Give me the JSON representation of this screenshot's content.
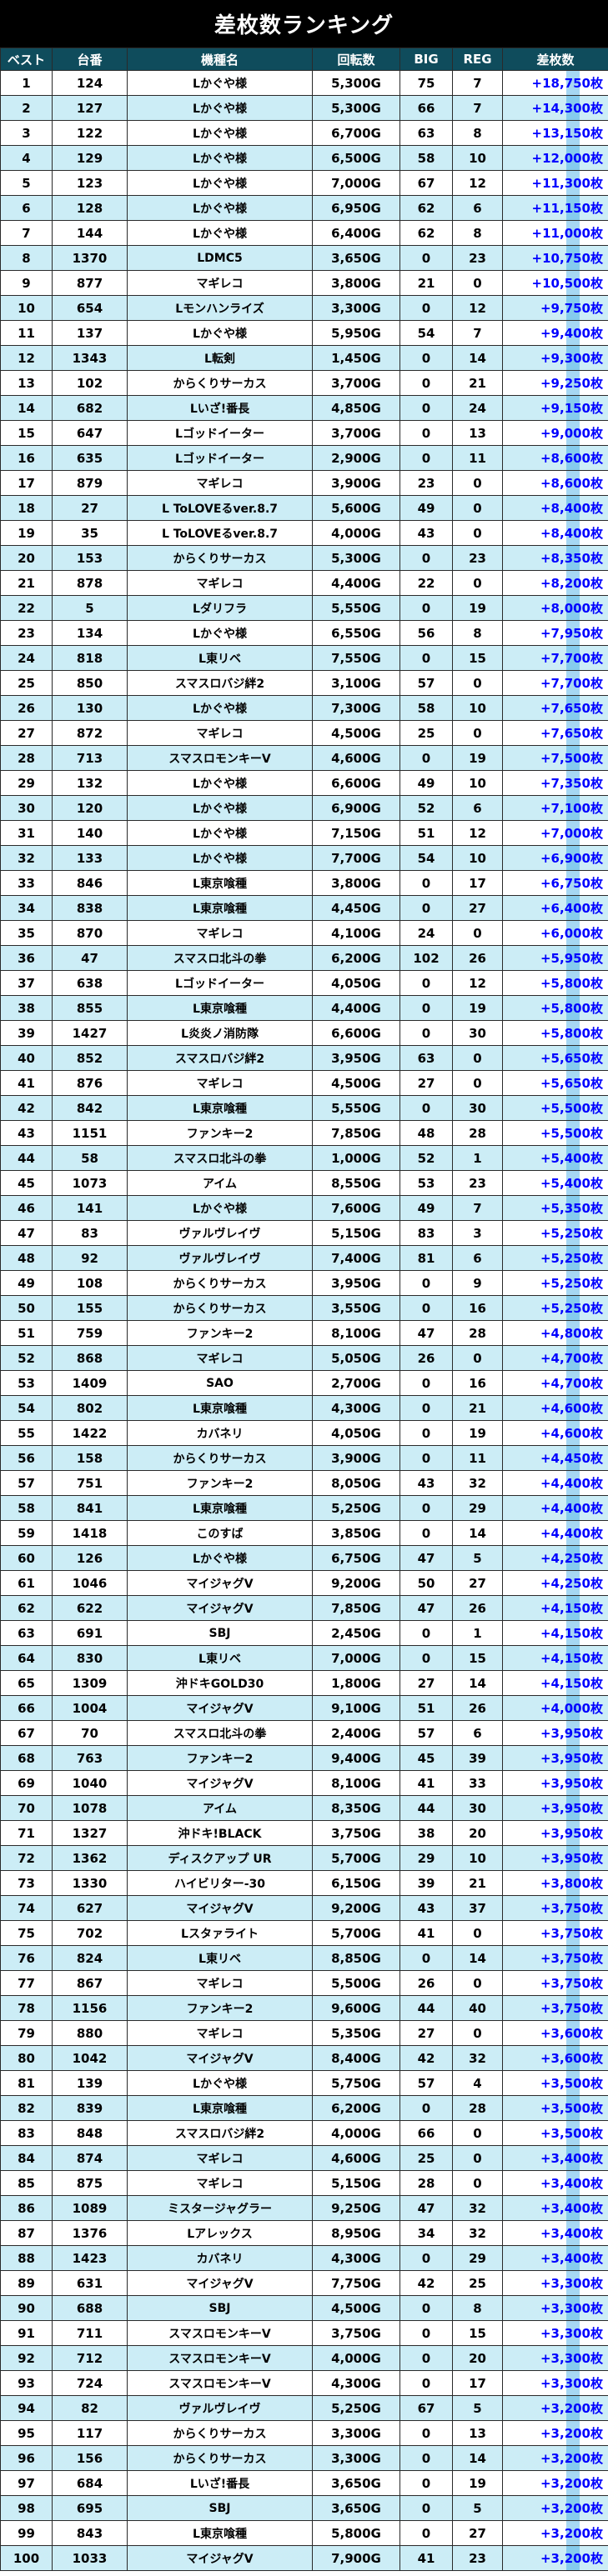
{
  "title": "差枚数ランキング",
  "headers": [
    "ベスト",
    "台番",
    "機種名",
    "回転数",
    "BIG",
    "REG",
    "差枚数"
  ],
  "rows": [
    [
      "1",
      "124",
      "Lかぐや様",
      "5,300G",
      "75",
      "7",
      "+18,750枚"
    ],
    [
      "2",
      "127",
      "Lかぐや様",
      "5,300G",
      "66",
      "7",
      "+14,300枚"
    ],
    [
      "3",
      "122",
      "Lかぐや様",
      "6,700G",
      "63",
      "8",
      "+13,150枚"
    ],
    [
      "4",
      "129",
      "Lかぐや様",
      "6,500G",
      "58",
      "10",
      "+12,000枚"
    ],
    [
      "5",
      "123",
      "Lかぐや様",
      "7,000G",
      "67",
      "12",
      "+11,300枚"
    ],
    [
      "6",
      "128",
      "Lかぐや様",
      "6,950G",
      "62",
      "6",
      "+11,150枚"
    ],
    [
      "7",
      "144",
      "Lかぐや様",
      "6,400G",
      "62",
      "8",
      "+11,000枚"
    ],
    [
      "8",
      "1370",
      "LDMC5",
      "3,650G",
      "0",
      "23",
      "+10,750枚"
    ],
    [
      "9",
      "877",
      "マギレコ",
      "3,800G",
      "21",
      "0",
      "+10,500枚"
    ],
    [
      "10",
      "654",
      "Lモンハンライズ",
      "3,300G",
      "0",
      "12",
      "+9,750枚"
    ],
    [
      "11",
      "137",
      "Lかぐや様",
      "5,950G",
      "54",
      "7",
      "+9,400枚"
    ],
    [
      "12",
      "1343",
      "L転剣",
      "1,450G",
      "0",
      "14",
      "+9,300枚"
    ],
    [
      "13",
      "102",
      "からくりサーカス",
      "3,700G",
      "0",
      "21",
      "+9,250枚"
    ],
    [
      "14",
      "682",
      "Lいざ!番長",
      "4,850G",
      "0",
      "24",
      "+9,150枚"
    ],
    [
      "15",
      "647",
      "Lゴッドイーター",
      "3,700G",
      "0",
      "13",
      "+9,000枚"
    ],
    [
      "16",
      "635",
      "Lゴッドイーター",
      "2,900G",
      "0",
      "11",
      "+8,600枚"
    ],
    [
      "17",
      "879",
      "マギレコ",
      "3,900G",
      "23",
      "0",
      "+8,600枚"
    ],
    [
      "18",
      "27",
      "L ToLOVEるver.8.7",
      "5,600G",
      "49",
      "0",
      "+8,400枚"
    ],
    [
      "19",
      "35",
      "L ToLOVEるver.8.7",
      "4,000G",
      "43",
      "0",
      "+8,400枚"
    ],
    [
      "20",
      "153",
      "からくりサーカス",
      "5,300G",
      "0",
      "23",
      "+8,350枚"
    ],
    [
      "21",
      "878",
      "マギレコ",
      "4,400G",
      "22",
      "0",
      "+8,200枚"
    ],
    [
      "22",
      "5",
      "Lダリフラ",
      "5,550G",
      "0",
      "19",
      "+8,000枚"
    ],
    [
      "23",
      "134",
      "Lかぐや様",
      "6,550G",
      "56",
      "8",
      "+7,950枚"
    ],
    [
      "24",
      "818",
      "L東リベ",
      "7,550G",
      "0",
      "15",
      "+7,700枚"
    ],
    [
      "25",
      "850",
      "スマスロバジ絆2",
      "3,100G",
      "57",
      "0",
      "+7,700枚"
    ],
    [
      "26",
      "130",
      "Lかぐや様",
      "7,300G",
      "58",
      "10",
      "+7,650枚"
    ],
    [
      "27",
      "872",
      "マギレコ",
      "4,500G",
      "25",
      "0",
      "+7,650枚"
    ],
    [
      "28",
      "713",
      "スマスロモンキーV",
      "4,600G",
      "0",
      "19",
      "+7,500枚"
    ],
    [
      "29",
      "132",
      "Lかぐや様",
      "6,600G",
      "49",
      "10",
      "+7,350枚"
    ],
    [
      "30",
      "120",
      "Lかぐや様",
      "6,900G",
      "52",
      "6",
      "+7,100枚"
    ],
    [
      "31",
      "140",
      "Lかぐや様",
      "7,150G",
      "51",
      "12",
      "+7,000枚"
    ],
    [
      "32",
      "133",
      "Lかぐや様",
      "7,700G",
      "54",
      "10",
      "+6,900枚"
    ],
    [
      "33",
      "846",
      "L東京喰種",
      "3,800G",
      "0",
      "17",
      "+6,750枚"
    ],
    [
      "34",
      "838",
      "L東京喰種",
      "4,450G",
      "0",
      "27",
      "+6,400枚"
    ],
    [
      "35",
      "870",
      "マギレコ",
      "4,100G",
      "24",
      "0",
      "+6,000枚"
    ],
    [
      "36",
      "47",
      "スマスロ北斗の拳",
      "6,200G",
      "102",
      "26",
      "+5,950枚"
    ],
    [
      "37",
      "638",
      "Lゴッドイーター",
      "4,050G",
      "0",
      "12",
      "+5,800枚"
    ],
    [
      "38",
      "855",
      "L東京喰種",
      "4,400G",
      "0",
      "19",
      "+5,800枚"
    ],
    [
      "39",
      "1427",
      "L炎炎ノ消防隊",
      "6,600G",
      "0",
      "30",
      "+5,800枚"
    ],
    [
      "40",
      "852",
      "スマスロバジ絆2",
      "3,950G",
      "63",
      "0",
      "+5,650枚"
    ],
    [
      "41",
      "876",
      "マギレコ",
      "4,500G",
      "27",
      "0",
      "+5,650枚"
    ],
    [
      "42",
      "842",
      "L東京喰種",
      "5,550G",
      "0",
      "30",
      "+5,500枚"
    ],
    [
      "43",
      "1151",
      "ファンキー2",
      "7,850G",
      "48",
      "28",
      "+5,500枚"
    ],
    [
      "44",
      "58",
      "スマスロ北斗の拳",
      "1,000G",
      "52",
      "1",
      "+5,400枚"
    ],
    [
      "45",
      "1073",
      "アイム",
      "8,550G",
      "53",
      "23",
      "+5,400枚"
    ],
    [
      "46",
      "141",
      "Lかぐや様",
      "7,600G",
      "49",
      "7",
      "+5,350枚"
    ],
    [
      "47",
      "83",
      "ヴァルヴレイヴ",
      "5,150G",
      "83",
      "3",
      "+5,250枚"
    ],
    [
      "48",
      "92",
      "ヴァルヴレイヴ",
      "7,400G",
      "81",
      "6",
      "+5,250枚"
    ],
    [
      "49",
      "108",
      "からくりサーカス",
      "3,950G",
      "0",
      "9",
      "+5,250枚"
    ],
    [
      "50",
      "155",
      "からくりサーカス",
      "3,550G",
      "0",
      "16",
      "+5,250枚"
    ],
    [
      "51",
      "759",
      "ファンキー2",
      "8,100G",
      "47",
      "28",
      "+4,800枚"
    ],
    [
      "52",
      "868",
      "マギレコ",
      "5,050G",
      "26",
      "0",
      "+4,700枚"
    ],
    [
      "53",
      "1409",
      "SAO",
      "2,700G",
      "0",
      "16",
      "+4,700枚"
    ],
    [
      "54",
      "802",
      "L東京喰種",
      "4,300G",
      "0",
      "21",
      "+4,600枚"
    ],
    [
      "55",
      "1422",
      "カバネリ",
      "4,050G",
      "0",
      "19",
      "+4,600枚"
    ],
    [
      "56",
      "158",
      "からくりサーカス",
      "3,900G",
      "0",
      "11",
      "+4,450枚"
    ],
    [
      "57",
      "751",
      "ファンキー2",
      "8,050G",
      "43",
      "32",
      "+4,400枚"
    ],
    [
      "58",
      "841",
      "L東京喰種",
      "5,250G",
      "0",
      "29",
      "+4,400枚"
    ],
    [
      "59",
      "1418",
      "このすば",
      "3,850G",
      "0",
      "14",
      "+4,400枚"
    ],
    [
      "60",
      "126",
      "Lかぐや様",
      "6,750G",
      "47",
      "5",
      "+4,250枚"
    ],
    [
      "61",
      "1046",
      "マイジャグV",
      "9,200G",
      "50",
      "27",
      "+4,250枚"
    ],
    [
      "62",
      "622",
      "マイジャグV",
      "7,850G",
      "47",
      "26",
      "+4,150枚"
    ],
    [
      "63",
      "691",
      "SBJ",
      "2,450G",
      "0",
      "1",
      "+4,150枚"
    ],
    [
      "64",
      "830",
      "L東リベ",
      "7,000G",
      "0",
      "15",
      "+4,150枚"
    ],
    [
      "65",
      "1309",
      "沖ドキGOLD30",
      "1,800G",
      "27",
      "14",
      "+4,150枚"
    ],
    [
      "66",
      "1004",
      "マイジャグV",
      "9,100G",
      "51",
      "26",
      "+4,000枚"
    ],
    [
      "67",
      "70",
      "スマスロ北斗の拳",
      "2,400G",
      "57",
      "6",
      "+3,950枚"
    ],
    [
      "68",
      "763",
      "ファンキー2",
      "9,400G",
      "45",
      "39",
      "+3,950枚"
    ],
    [
      "69",
      "1040",
      "マイジャグV",
      "8,100G",
      "41",
      "33",
      "+3,950枚"
    ],
    [
      "70",
      "1078",
      "アイム",
      "8,350G",
      "44",
      "30",
      "+3,950枚"
    ],
    [
      "71",
      "1327",
      "沖ドキ!BLACK",
      "3,750G",
      "38",
      "20",
      "+3,950枚"
    ],
    [
      "72",
      "1362",
      "ディスクアップ UR",
      "5,700G",
      "29",
      "10",
      "+3,950枚"
    ],
    [
      "73",
      "1330",
      "ハイビリター-30",
      "6,150G",
      "39",
      "21",
      "+3,800枚"
    ],
    [
      "74",
      "627",
      "マイジャグV",
      "9,200G",
      "43",
      "37",
      "+3,750枚"
    ],
    [
      "75",
      "702",
      "Lスタァライト",
      "5,700G",
      "41",
      "0",
      "+3,750枚"
    ],
    [
      "76",
      "824",
      "L東リベ",
      "8,850G",
      "0",
      "14",
      "+3,750枚"
    ],
    [
      "77",
      "867",
      "マギレコ",
      "5,500G",
      "26",
      "0",
      "+3,750枚"
    ],
    [
      "78",
      "1156",
      "ファンキー2",
      "9,600G",
      "44",
      "40",
      "+3,750枚"
    ],
    [
      "79",
      "880",
      "マギレコ",
      "5,350G",
      "27",
      "0",
      "+3,600枚"
    ],
    [
      "80",
      "1042",
      "マイジャグV",
      "8,400G",
      "42",
      "32",
      "+3,600枚"
    ],
    [
      "81",
      "139",
      "Lかぐや様",
      "5,750G",
      "57",
      "4",
      "+3,500枚"
    ],
    [
      "82",
      "839",
      "L東京喰種",
      "6,200G",
      "0",
      "28",
      "+3,500枚"
    ],
    [
      "83",
      "848",
      "スマスロバジ絆2",
      "4,000G",
      "66",
      "0",
      "+3,500枚"
    ],
    [
      "84",
      "874",
      "マギレコ",
      "4,600G",
      "25",
      "0",
      "+3,400枚"
    ],
    [
      "85",
      "875",
      "マギレコ",
      "5,150G",
      "28",
      "0",
      "+3,400枚"
    ],
    [
      "86",
      "1089",
      "ミスタージャグラー",
      "9,250G",
      "47",
      "32",
      "+3,400枚"
    ],
    [
      "87",
      "1376",
      "Lアレックス",
      "8,950G",
      "34",
      "32",
      "+3,400枚"
    ],
    [
      "88",
      "1423",
      "カバネリ",
      "4,300G",
      "0",
      "29",
      "+3,400枚"
    ],
    [
      "89",
      "631",
      "マイジャグV",
      "7,750G",
      "42",
      "25",
      "+3,300枚"
    ],
    [
      "90",
      "688",
      "SBJ",
      "4,500G",
      "0",
      "8",
      "+3,300枚"
    ],
    [
      "91",
      "711",
      "スマスロモンキーV",
      "3,750G",
      "0",
      "15",
      "+3,300枚"
    ],
    [
      "92",
      "712",
      "スマスロモンキーV",
      "4,000G",
      "0",
      "20",
      "+3,300枚"
    ],
    [
      "93",
      "724",
      "スマスロモンキーV",
      "4,300G",
      "0",
      "17",
      "+3,300枚"
    ],
    [
      "94",
      "82",
      "ヴァルヴレイヴ",
      "5,250G",
      "67",
      "5",
      "+3,200枚"
    ],
    [
      "95",
      "117",
      "からくりサーカス",
      "3,300G",
      "0",
      "13",
      "+3,200枚"
    ],
    [
      "96",
      "156",
      "からくりサーカス",
      "3,300G",
      "0",
      "14",
      "+3,200枚"
    ],
    [
      "97",
      "684",
      "Lいざ!番長",
      "3,650G",
      "0",
      "19",
      "+3,200枚"
    ],
    [
      "98",
      "695",
      "SBJ",
      "3,650G",
      "0",
      "5",
      "+3,200枚"
    ],
    [
      "99",
      "843",
      "L東京喰種",
      "5,800G",
      "0",
      "27",
      "+3,200枚"
    ],
    [
      "100",
      "1033",
      "マイジャグV",
      "7,900G",
      "41",
      "23",
      "+3,200枚"
    ]
  ]
}
